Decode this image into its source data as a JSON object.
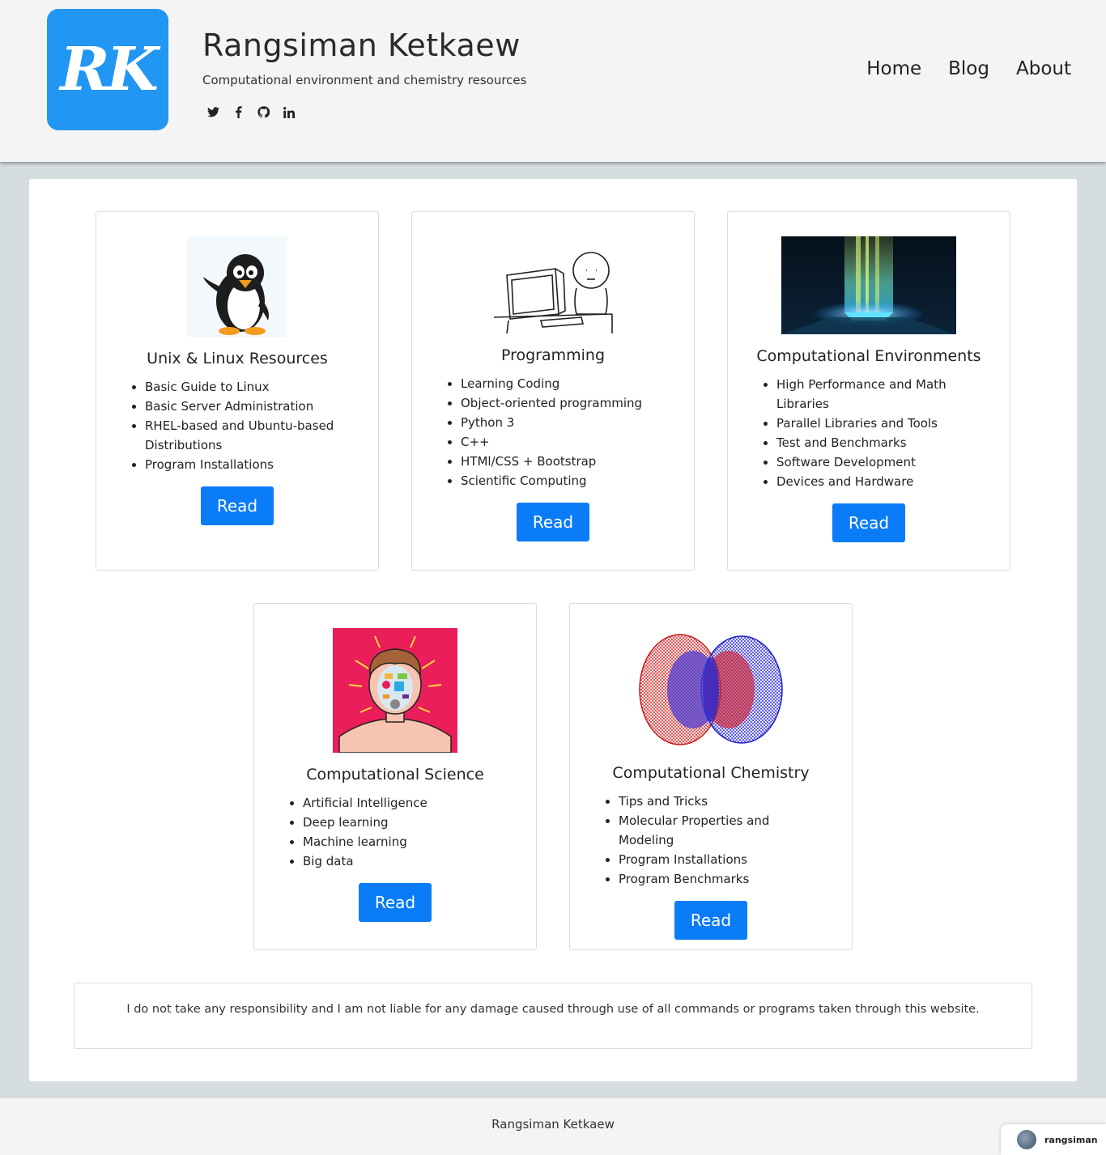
{
  "header": {
    "logo_text": "RK",
    "title": "Rangsiman Ketkaew",
    "tagline": "Computational environment and chemistry resources",
    "social": [
      "twitter-icon",
      "facebook-icon",
      "github-icon",
      "linkedin-icon"
    ],
    "nav": [
      "Home",
      "Blog",
      "About"
    ]
  },
  "cards": [
    {
      "title": "Unix & Linux Resources",
      "image": "penguin-image",
      "items": [
        "Basic Guide to Linux",
        "Basic Server Administration",
        "RHEL-based and Ubuntu-based Distributions",
        "Program Installations"
      ],
      "button": "Read"
    },
    {
      "title": "Programming",
      "image": "programmer-sketch-image",
      "items": [
        "Learning Coding",
        "Object-oriented programming",
        "Python 3",
        "C++",
        "HTMl/CSS + Bootstrap",
        "Scientific Computing"
      ],
      "button": "Read"
    },
    {
      "title": "Computational Environments",
      "image": "processor-chip-image",
      "items": [
        "High Performance and Math Libraries",
        "Parallel Libraries and Tools",
        "Test and Benchmarks",
        "Software Development",
        "Devices and Hardware"
      ],
      "button": "Read"
    },
    {
      "title": "Computational Science",
      "image": "ai-face-image",
      "items": [
        "Artificial Intelligence",
        "Deep learning",
        "Machine learning",
        "Big data"
      ],
      "button": "Read"
    },
    {
      "title": "Computational Chemistry",
      "image": "orbital-image",
      "items": [
        "Tips and Tricks",
        "Molecular Properties and Modeling",
        "Program Installations",
        "Program Benchmarks"
      ],
      "button": "Read"
    }
  ],
  "disclaimer": "I do not take any responsibility and I am not liable for any damage caused through use of all commands or programs taken through this website.",
  "footer": {
    "text": "Rangsiman Ketkaew",
    "badge_name": "rangsiman"
  },
  "colors": {
    "logo_bg": "#2196f3",
    "button_bg": "#0a7cf7",
    "page_bg": "#d5dde0",
    "header_bg": "#f4f4f4",
    "card_image_pink": "#e91e5a"
  }
}
